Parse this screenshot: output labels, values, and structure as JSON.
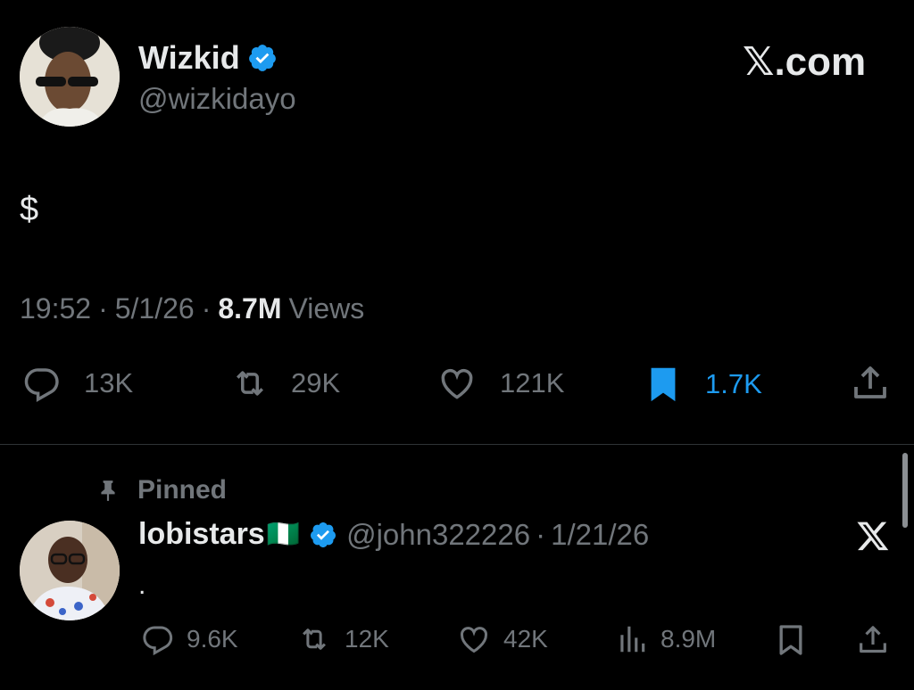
{
  "watermark": "𝕏.com",
  "tweet": {
    "author_name": "Wizkid",
    "author_handle": "@wizkidayo",
    "text": "$",
    "time": "19:52",
    "date": "5/1/26",
    "views_count": "8.7M",
    "views_label": "Views",
    "separator": "·",
    "replies": "13K",
    "retweets": "29K",
    "likes": "121K",
    "bookmarks": "1.7K",
    "accent": "#1d9bf0"
  },
  "pinned": {
    "label": "Pinned",
    "author_name": "lobistars",
    "flag": "🇳🇬",
    "author_handle": "@john322226",
    "separator": "·",
    "date": "1/21/26",
    "text": ".",
    "replies": "9.6K",
    "retweets": "12K",
    "likes": "42K",
    "views": "8.9M"
  },
  "icons": [
    "verified-badge-icon",
    "reply-icon",
    "retweet-icon",
    "like-icon",
    "bookmark-icon",
    "share-icon",
    "pin-icon",
    "views-icon",
    "x-logo-icon"
  ]
}
